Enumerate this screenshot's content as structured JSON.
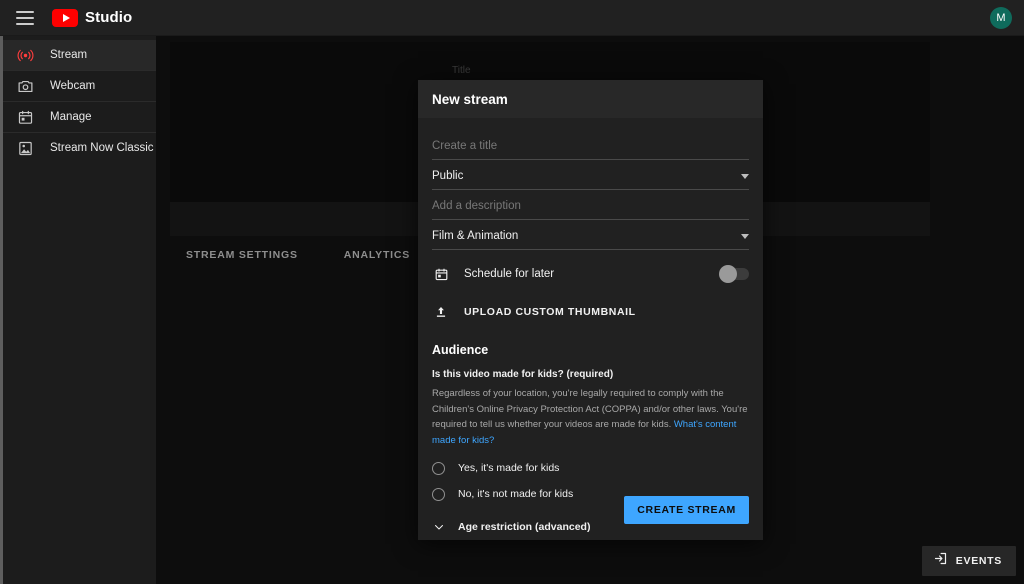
{
  "topbar": {
    "menu_icon": "hamburger-icon",
    "logo_icon": "youtube-logo-icon",
    "brand": "Studio",
    "avatar_initial": "M"
  },
  "sidebar": {
    "items": [
      {
        "label": "Stream",
        "icon": "broadcast-icon",
        "active": true
      },
      {
        "label": "Webcam",
        "icon": "camera-icon",
        "active": false
      },
      {
        "label": "Manage",
        "icon": "calendar-icon",
        "active": false
      },
      {
        "label": "Stream Now Classic",
        "icon": "legacy-stream-icon",
        "active": false
      }
    ]
  },
  "main": {
    "background_title_label": "Title",
    "tabs": [
      {
        "label": "STREAM SETTINGS"
      },
      {
        "label": "ANALYTICS"
      }
    ],
    "events_button": {
      "label": "EVENTS",
      "icon": "arrow-into-box-icon"
    }
  },
  "dialog": {
    "title": "New stream",
    "title_field": {
      "placeholder": "Create a title",
      "value": ""
    },
    "visibility_select": {
      "value": "Public",
      "icon": "chevron-down-icon"
    },
    "description_field": {
      "placeholder": "Add a description",
      "value": ""
    },
    "category_select": {
      "value": "Film & Animation",
      "icon": "chevron-down-icon"
    },
    "schedule": {
      "label": "Schedule for later",
      "icon": "calendar-icon",
      "toggle_on": false
    },
    "upload_thumbnail": {
      "label": "UPLOAD CUSTOM THUMBNAIL",
      "icon": "upload-icon"
    },
    "audience": {
      "heading": "Audience",
      "question": "Is this video made for kids? (required)",
      "description": "Regardless of your location, you're legally required to comply with the Children's Online Privacy Protection Act (COPPA) and/or other laws. You're required to tell us whether your videos are made for kids.",
      "link_text": "What's content made for kids?",
      "options": [
        {
          "label": "Yes, it's made for kids",
          "selected": false
        },
        {
          "label": "No, it's not made for kids",
          "selected": false
        }
      ]
    },
    "age_restriction": {
      "label": "Age restriction (advanced)",
      "icon": "chevron-down-icon"
    },
    "create_button": {
      "label": "CREATE STREAM"
    }
  },
  "colors": {
    "accent_blue": "#3ea6ff",
    "brand_red": "#ff0000",
    "avatar_green": "#0f6b5c",
    "dialog_bg": "#212121",
    "page_bg": "#0d0d0d"
  }
}
